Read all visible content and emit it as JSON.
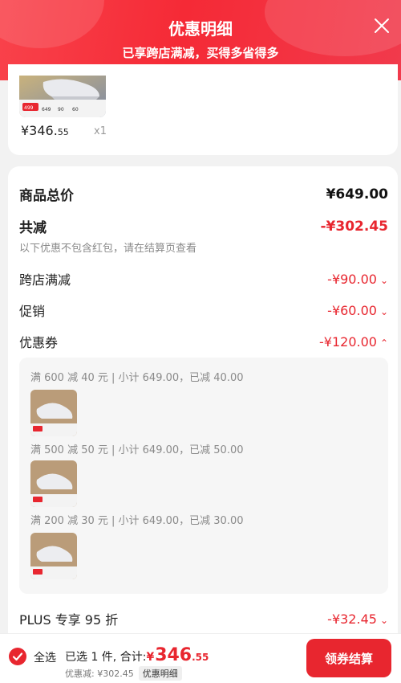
{
  "header": {
    "title": "优惠明细",
    "subtitle": "已享跨店满减，买得多省得多",
    "close_icon": "close-icon"
  },
  "product": {
    "price_main": "¥346.",
    "price_decimal": "55",
    "quantity": "x1",
    "image_badge_prices": [
      "499",
      "649",
      "90",
      "60"
    ]
  },
  "summary": {
    "goods_total_label": "商品总价",
    "goods_total_value": "¥649.00",
    "total_discount_label": "共减",
    "total_discount_value": "-¥302.45",
    "note": "以下优惠不包含红包，请在结算页查看",
    "items": [
      {
        "label": "跨店满减",
        "value": "-¥90.00",
        "chevron": "⌄"
      },
      {
        "label": "促销",
        "value": "-¥60.00",
        "chevron": "⌄"
      },
      {
        "label": "优惠券",
        "value": "-¥120.00",
        "chevron": "⌃"
      }
    ],
    "coupons": [
      {
        "text": "满 600 减 40 元 | 小计 649.00，已减 40.00"
      },
      {
        "text": "满 500 减 50 元 | 小计 649.00，已减 50.00"
      },
      {
        "text": "满 200 减 30 元 | 小计 649.00，已减 30.00"
      }
    ],
    "plus_label": "PLUS 专享 95 折",
    "plus_value": "-¥32.45",
    "plus_chevron": "⌄"
  },
  "bottom": {
    "select_all": "全选",
    "selected_text": "已选 1 件, 合计:",
    "yen": "¥",
    "total_int": "346",
    "total_dec": ".55",
    "discount_text": "优惠减: ¥302.45",
    "detail_tag": "优惠明细",
    "checkout_label": "领券结算"
  },
  "colors": {
    "accent_red": "#e8262f",
    "header_red": "#f52a36"
  }
}
